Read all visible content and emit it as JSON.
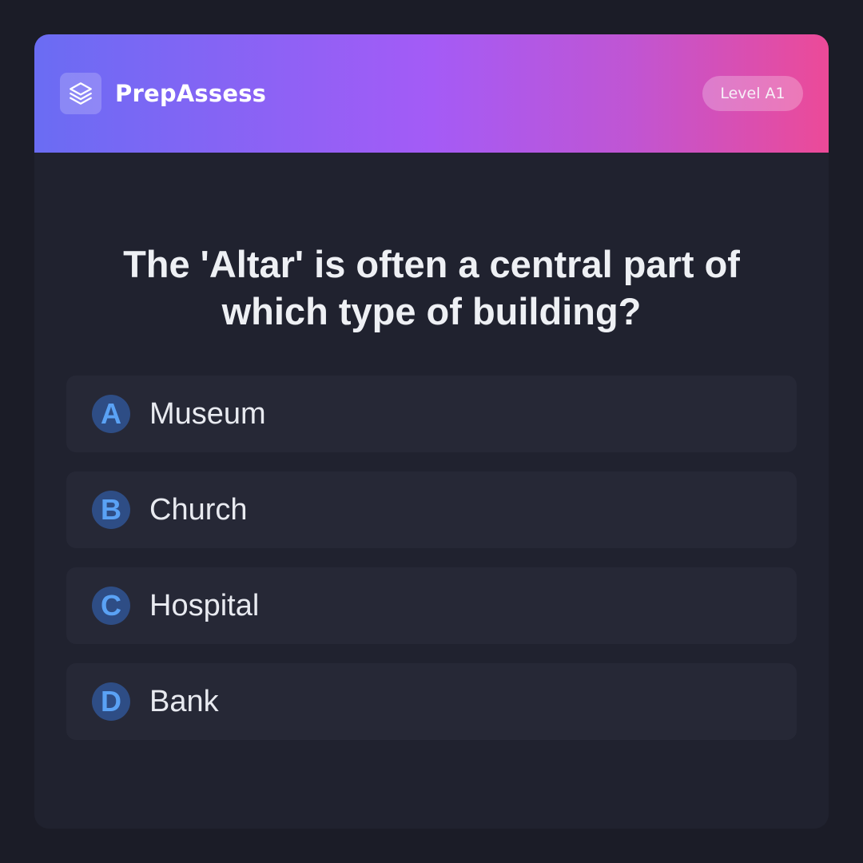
{
  "app": {
    "brand": "PrepAssess",
    "logo_icon": "layers-icon",
    "level_badge": "Level A1"
  },
  "colors": {
    "background": "#1b1c27",
    "card": "#20222f",
    "option_bg": "#262836",
    "header_gradient": [
      "#6a6cf3",
      "#a45bf6",
      "#ec4a98"
    ],
    "letter_bg": "#2e4d85",
    "letter_text": "#5aa2f5"
  },
  "question": {
    "text": "The 'Altar' is often a central part of which type of building?"
  },
  "options": [
    {
      "letter": "A",
      "label": "Museum"
    },
    {
      "letter": "B",
      "label": "Church"
    },
    {
      "letter": "C",
      "label": "Hospital"
    },
    {
      "letter": "D",
      "label": "Bank"
    }
  ]
}
